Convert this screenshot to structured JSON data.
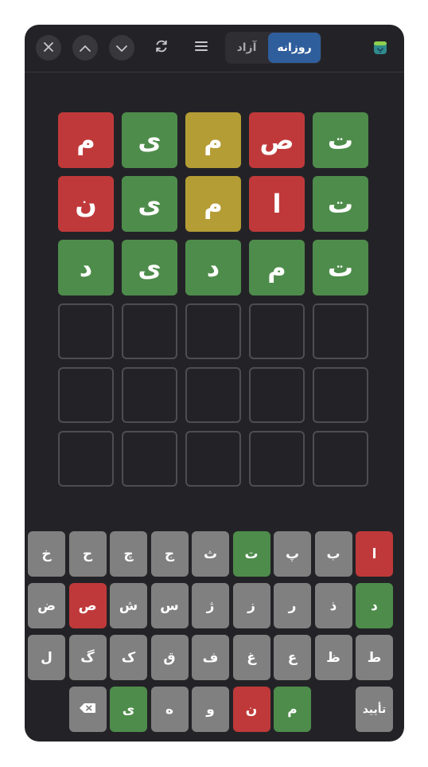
{
  "header": {
    "tabs": [
      {
        "id": "daily",
        "label": "روزانه",
        "active": true
      },
      {
        "id": "free",
        "label": "آزاد",
        "active": false
      }
    ],
    "icons": [
      "close-icon",
      "chevron-up-icon",
      "chevron-down-icon",
      "refresh-icon",
      "menu-icon",
      "app-icon"
    ]
  },
  "board": {
    "columns": 5,
    "rows": [
      [
        {
          "letter": "ت",
          "state": "green"
        },
        {
          "letter": "ص",
          "state": "red"
        },
        {
          "letter": "م",
          "state": "yellow"
        },
        {
          "letter": "ی",
          "state": "green"
        },
        {
          "letter": "م",
          "state": "red"
        }
      ],
      [
        {
          "letter": "ت",
          "state": "green"
        },
        {
          "letter": "ا",
          "state": "red"
        },
        {
          "letter": "م",
          "state": "yellow"
        },
        {
          "letter": "ی",
          "state": "green"
        },
        {
          "letter": "ن",
          "state": "red"
        }
      ],
      [
        {
          "letter": "ت",
          "state": "green"
        },
        {
          "letter": "م",
          "state": "green"
        },
        {
          "letter": "د",
          "state": "green"
        },
        {
          "letter": "ی",
          "state": "green"
        },
        {
          "letter": "د",
          "state": "green"
        }
      ],
      [
        {
          "letter": "",
          "state": "empty"
        },
        {
          "letter": "",
          "state": "empty"
        },
        {
          "letter": "",
          "state": "empty"
        },
        {
          "letter": "",
          "state": "empty"
        },
        {
          "letter": "",
          "state": "empty"
        }
      ],
      [
        {
          "letter": "",
          "state": "empty"
        },
        {
          "letter": "",
          "state": "empty"
        },
        {
          "letter": "",
          "state": "empty"
        },
        {
          "letter": "",
          "state": "empty"
        },
        {
          "letter": "",
          "state": "empty"
        }
      ],
      [
        {
          "letter": "",
          "state": "empty"
        },
        {
          "letter": "",
          "state": "empty"
        },
        {
          "letter": "",
          "state": "empty"
        },
        {
          "letter": "",
          "state": "empty"
        },
        {
          "letter": "",
          "state": "empty"
        }
      ]
    ]
  },
  "keyboard": {
    "rows": [
      [
        {
          "label": "ا",
          "state": "red"
        },
        {
          "label": "ب",
          "state": "normal"
        },
        {
          "label": "پ",
          "state": "normal"
        },
        {
          "label": "ت",
          "state": "green"
        },
        {
          "label": "ث",
          "state": "normal"
        },
        {
          "label": "ج",
          "state": "normal"
        },
        {
          "label": "چ",
          "state": "normal"
        },
        {
          "label": "ح",
          "state": "normal"
        },
        {
          "label": "خ",
          "state": "normal"
        }
      ],
      [
        {
          "label": "د",
          "state": "green"
        },
        {
          "label": "ذ",
          "state": "normal"
        },
        {
          "label": "ر",
          "state": "normal"
        },
        {
          "label": "ز",
          "state": "normal"
        },
        {
          "label": "ژ",
          "state": "normal"
        },
        {
          "label": "س",
          "state": "normal"
        },
        {
          "label": "ش",
          "state": "normal"
        },
        {
          "label": "ص",
          "state": "red"
        },
        {
          "label": "ض",
          "state": "normal"
        }
      ],
      [
        {
          "label": "ط",
          "state": "normal"
        },
        {
          "label": "ظ",
          "state": "normal"
        },
        {
          "label": "ع",
          "state": "normal"
        },
        {
          "label": "غ",
          "state": "normal"
        },
        {
          "label": "ف",
          "state": "normal"
        },
        {
          "label": "ق",
          "state": "normal"
        },
        {
          "label": "ک",
          "state": "normal"
        },
        {
          "label": "گ",
          "state": "normal"
        },
        {
          "label": "ل",
          "state": "normal"
        }
      ],
      [
        {
          "label": "تأیید",
          "state": "normal",
          "type": "enter"
        },
        {
          "label": "",
          "state": "gap"
        },
        {
          "label": "م",
          "state": "green"
        },
        {
          "label": "ن",
          "state": "red"
        },
        {
          "label": "و",
          "state": "normal"
        },
        {
          "label": "ه",
          "state": "normal"
        },
        {
          "label": "ی",
          "state": "green"
        },
        {
          "label": "",
          "state": "normal",
          "type": "backspace",
          "icon": "backspace-icon"
        }
      ]
    ]
  },
  "colors": {
    "green": "#4e8c4b",
    "yellow": "#b59d35",
    "red": "#c0393a",
    "key": "#808080",
    "background": "#232327",
    "accent": "#2f5e9c"
  }
}
